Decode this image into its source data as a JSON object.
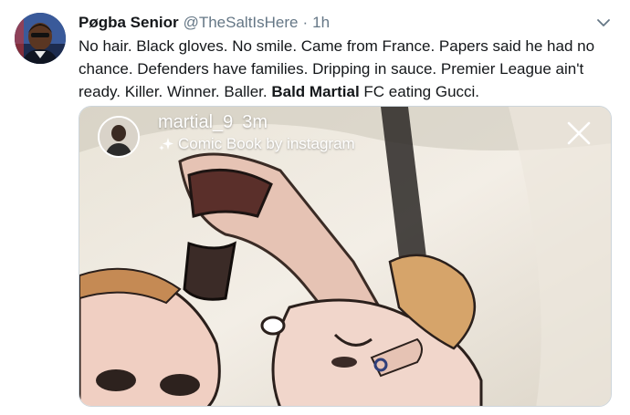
{
  "tweet": {
    "author": {
      "display_name": "Pøgba Senior",
      "handle": "@TheSaltIsHere",
      "separator": "·",
      "time": "1h"
    },
    "text": {
      "part1": "No hair. Black gloves. No smile. Came from France. Papers said he had no chance. Defenders have families. Dripping in sauce. Premier League ain't ready. Killer. Winner. Baller. ",
      "bold": "Bald Martial",
      "part2": " FC eating Gucci."
    },
    "icons": {
      "menu": "chevron-down-icon",
      "sparkle": "sparkle-icon",
      "close": "close-icon"
    }
  },
  "story": {
    "username": "martial_9",
    "time": "3m",
    "filter_label": "Comic Book by instagram"
  },
  "colors": {
    "text_primary": "#14171a",
    "text_secondary": "#657786",
    "story_text": "#ffffff",
    "media_border": "#cdd5db"
  }
}
